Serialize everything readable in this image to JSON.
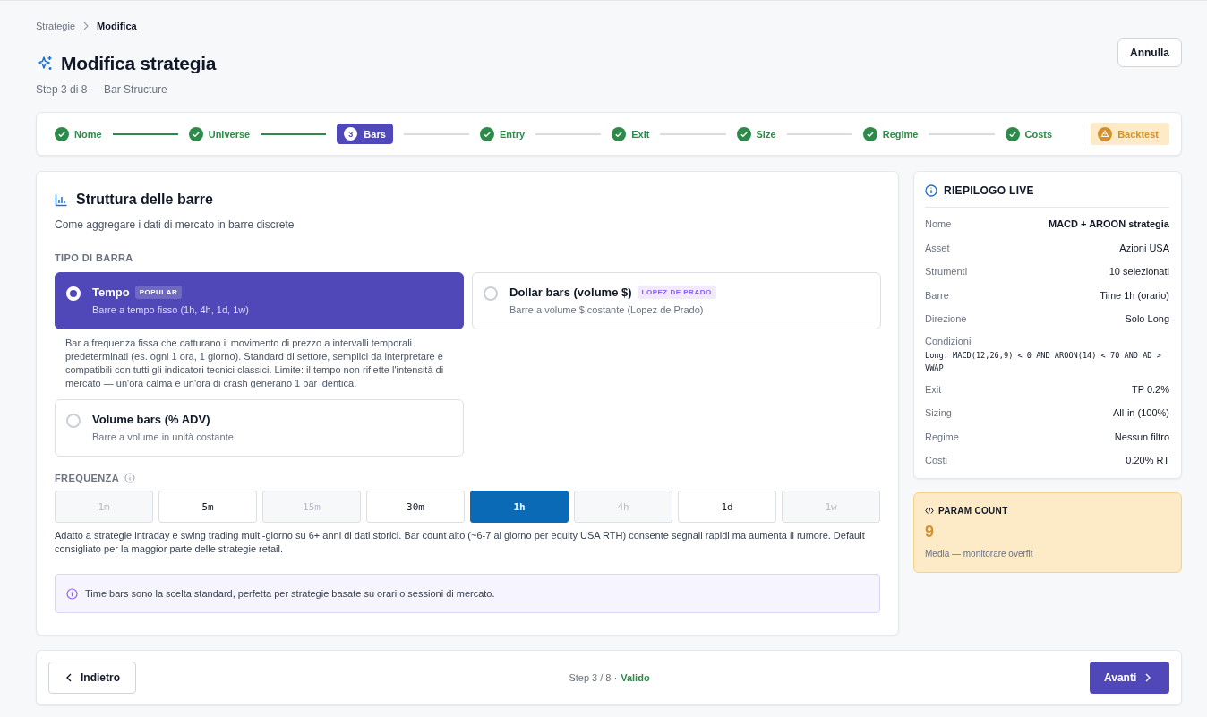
{
  "breadcrumb": [
    {
      "label": "Strategie",
      "current": false
    },
    {
      "label": "Modifica",
      "current": true
    }
  ],
  "header": {
    "title": "Modifica strategia",
    "subtitle": "Step 3 di 8 — Bar Structure",
    "cancel_button": "Annulla"
  },
  "stepper": {
    "steps": [
      {
        "label": "Nome",
        "completed": true,
        "selected": false
      },
      {
        "label": "Universe",
        "completed": true,
        "selected": false
      },
      {
        "label": "Bars",
        "number": "3",
        "completed": false,
        "selected": true
      },
      {
        "label": "Entry",
        "completed": true,
        "selected": false
      },
      {
        "label": "Exit",
        "completed": true,
        "selected": false
      },
      {
        "label": "Size",
        "completed": true,
        "selected": false
      },
      {
        "label": "Regime",
        "completed": true,
        "selected": false
      },
      {
        "label": "Costs",
        "completed": true,
        "selected": false
      }
    ],
    "backtest": {
      "label": "Backtest",
      "warning": true
    }
  },
  "panel": {
    "title": "Struttura delle barre",
    "subtitle": "Come aggregare i dati di mercato in barre discrete",
    "bar_type_label": "TIPO DI BARRA",
    "bar_types": [
      {
        "title": "Tempo",
        "badge": "POPULAR",
        "description": "Barre a tempo fisso (1h, 4h, 1d, 1w)",
        "selected": true
      },
      {
        "title": "Dollar bars (volume $)",
        "badge": "LOPEZ DE PRADO",
        "description": "Barre a volume $ costante (Lopez de Prado)",
        "selected": false
      },
      {
        "title": "Volume bars (% ADV)",
        "description": "Barre a volume in unità costante",
        "selected": false
      }
    ],
    "bar_type_note": "Bar a frequenza fissa che catturano il movimento di prezzo a intervalli temporali predeterminati (es. ogni 1 ora, 1 giorno). Standard di settore, semplici da interpretare e compatibili con tutti gli indicatori tecnici classici. Limite: il tempo non riflette l'intensità di mercato — un'ora calma e un'ora di crash generano 1 bar identica.",
    "frequency_label": "FREQUENZA",
    "frequencies": [
      {
        "label": "1m",
        "disabled": true,
        "selected": false
      },
      {
        "label": "5m",
        "disabled": false,
        "selected": false
      },
      {
        "label": "15m",
        "disabled": true,
        "selected": false
      },
      {
        "label": "30m",
        "disabled": false,
        "selected": false
      },
      {
        "label": "1h",
        "disabled": false,
        "selected": true
      },
      {
        "label": "4h",
        "disabled": true,
        "selected": false
      },
      {
        "label": "1d",
        "disabled": false,
        "selected": false
      },
      {
        "label": "1w",
        "disabled": true,
        "selected": false
      }
    ],
    "frequency_note": "Adatto a strategie intraday e swing trading multi-giorno su 6+ anni di dati storici. Bar count alto (~6-7 al giorno per equity USA RTH) consente segnali rapidi ma aumenta il rumore. Default consigliato per la maggior parte delle strategie retail.",
    "info": "Time bars sono la scelta standard, perfetta per strategie basate su orari o sessioni di mercato."
  },
  "summary": {
    "title": "RIEPILOGO LIVE",
    "rows": [
      {
        "kind": "pair",
        "label": "Nome",
        "value": "MACD + AROON strategia",
        "emphasis": true
      },
      {
        "kind": "pair",
        "label": "Asset",
        "value": "Azioni USA",
        "emphasis": false
      },
      {
        "kind": "pair",
        "label": "Strumenti",
        "value": "10 selezionati",
        "emphasis": false
      },
      {
        "kind": "pair",
        "label": "Barre",
        "value": "Time 1h (orario)",
        "emphasis": false
      },
      {
        "kind": "pair",
        "label": "Direzione",
        "value": "Solo Long",
        "emphasis": false
      },
      {
        "kind": "code",
        "label": "Condizioni",
        "value": "Long: MACD(12,26,9) < 0 AND AROON(14) < 70 AND AD > VWAP",
        "emphasis": false
      },
      {
        "kind": "pair",
        "label": "Exit",
        "value": "TP 0.2%",
        "emphasis": false
      },
      {
        "kind": "pair",
        "label": "Sizing",
        "value": "All-in (100%)",
        "emphasis": false
      },
      {
        "kind": "pair",
        "label": "Regime",
        "value": "Nessun filtro",
        "emphasis": false
      },
      {
        "kind": "pair",
        "label": "Costi",
        "value": "0.20% RT",
        "emphasis": false
      }
    ]
  },
  "param_count": {
    "title": "PARAM COUNT",
    "value": "9",
    "note": "Media — monitorare overfit",
    "warning": true
  },
  "footer": {
    "back_button": "Indietro",
    "step_text": "Step 3 / 8 ·",
    "status": "Valido",
    "valid": true,
    "next_button": "Avanti"
  }
}
